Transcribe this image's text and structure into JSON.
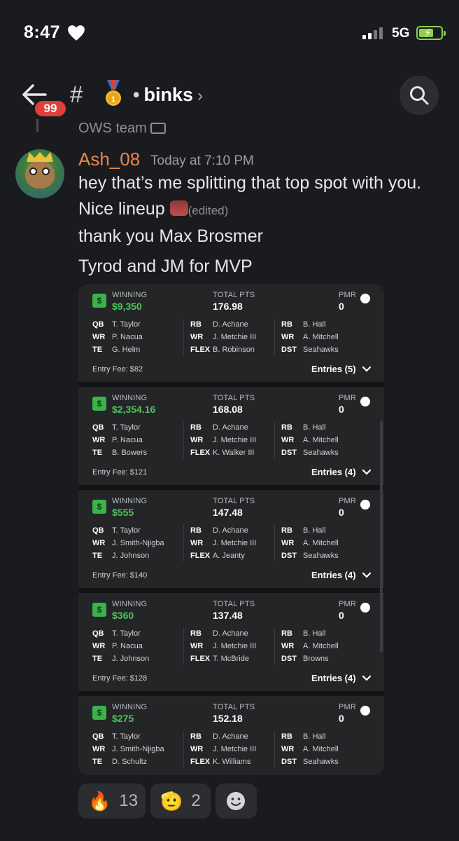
{
  "status_bar": {
    "time": "8:47",
    "network": "5G",
    "heart_icon": "heart-icon",
    "battery_icon": "battery-charging-icon"
  },
  "header": {
    "back_badge": "99",
    "channel_prefix": "#",
    "medal_icon": "gold-medal-icon",
    "channel_name": "binks",
    "chevron": "›",
    "search_icon": "search-icon"
  },
  "message": {
    "reply_preview": "OWS team",
    "username": "Ash_08",
    "timestamp": "Today at 7:10 PM",
    "line1": "hey that’s me splitting that top spot with you.",
    "line2": "Nice lineup",
    "edited": "(edited)",
    "line3": "thank you Max Brosmer",
    "line4": "Tyrod and JM for MVP"
  },
  "labels": {
    "winning": "WINNING",
    "total_pts": "TOTAL PTS",
    "pmr": "PMR"
  },
  "entries": [
    {
      "winning": "$9,350",
      "total_pts": "176.98",
      "pmr": "0",
      "rows": [
        [
          "QB",
          "T. Taylor",
          "RB",
          "D. Achane",
          "RB",
          "B. Hall"
        ],
        [
          "WR",
          "P. Nacua",
          "WR",
          "J. Metchie III",
          "WR",
          "A. Mitchell"
        ],
        [
          "TE",
          "G. Helm",
          "FLEX",
          "B. Robinson",
          "DST",
          "Seahawks"
        ]
      ],
      "entry_fee": "Entry Fee: $82",
      "entries_label": "Entries (5)"
    },
    {
      "winning": "$2,354.16",
      "total_pts": "168.08",
      "pmr": "0",
      "rows": [
        [
          "QB",
          "T. Taylor",
          "RB",
          "D. Achane",
          "RB",
          "B. Hall"
        ],
        [
          "WR",
          "P. Nacua",
          "WR",
          "J. Metchie III",
          "WR",
          "A. Mitchell"
        ],
        [
          "TE",
          "B. Bowers",
          "FLEX",
          "K. Walker III",
          "DST",
          "Seahawks"
        ]
      ],
      "entry_fee": "Entry Fee: $121",
      "entries_label": "Entries (4)"
    },
    {
      "winning": "$555",
      "total_pts": "147.48",
      "pmr": "0",
      "rows": [
        [
          "QB",
          "T. Taylor",
          "RB",
          "D. Achane",
          "RB",
          "B. Hall"
        ],
        [
          "WR",
          "J. Smith-Njigba",
          "WR",
          "J. Metchie III",
          "WR",
          "A. Mitchell"
        ],
        [
          "TE",
          "J. Johnson",
          "FLEX",
          "A. Jeanty",
          "DST",
          "Seahawks"
        ]
      ],
      "entry_fee": "Entry Fee: $140",
      "entries_label": "Entries (4)"
    },
    {
      "winning": "$360",
      "total_pts": "137.48",
      "pmr": "0",
      "rows": [
        [
          "QB",
          "T. Taylor",
          "RB",
          "D. Achane",
          "RB",
          "B. Hall"
        ],
        [
          "WR",
          "P. Nacua",
          "WR",
          "J. Metchie III",
          "WR",
          "A. Mitchell"
        ],
        [
          "TE",
          "J. Johnson",
          "FLEX",
          "T. McBride",
          "DST",
          "Browns"
        ]
      ],
      "entry_fee": "Entry Fee: $128",
      "entries_label": "Entries (4)"
    },
    {
      "winning": "$275",
      "total_pts": "152.18",
      "pmr": "0",
      "rows": [
        [
          "QB",
          "T. Taylor",
          "RB",
          "D. Achane",
          "RB",
          "B. Hall"
        ],
        [
          "WR",
          "J. Smith-Njigba",
          "WR",
          "J. Metchie III",
          "WR",
          "A. Mitchell"
        ],
        [
          "TE",
          "D. Schultz",
          "FLEX",
          "K. Williams",
          "DST",
          "Seahawks"
        ]
      ],
      "entry_fee": "",
      "entries_label": ""
    }
  ],
  "reactions": [
    {
      "emoji": "🔥",
      "icon": "fire-icon",
      "count": "13"
    },
    {
      "emoji": "🫡",
      "icon": "salute-icon",
      "count": "2"
    },
    {
      "emoji": "",
      "icon": "add-reaction-icon",
      "count": ""
    }
  ]
}
